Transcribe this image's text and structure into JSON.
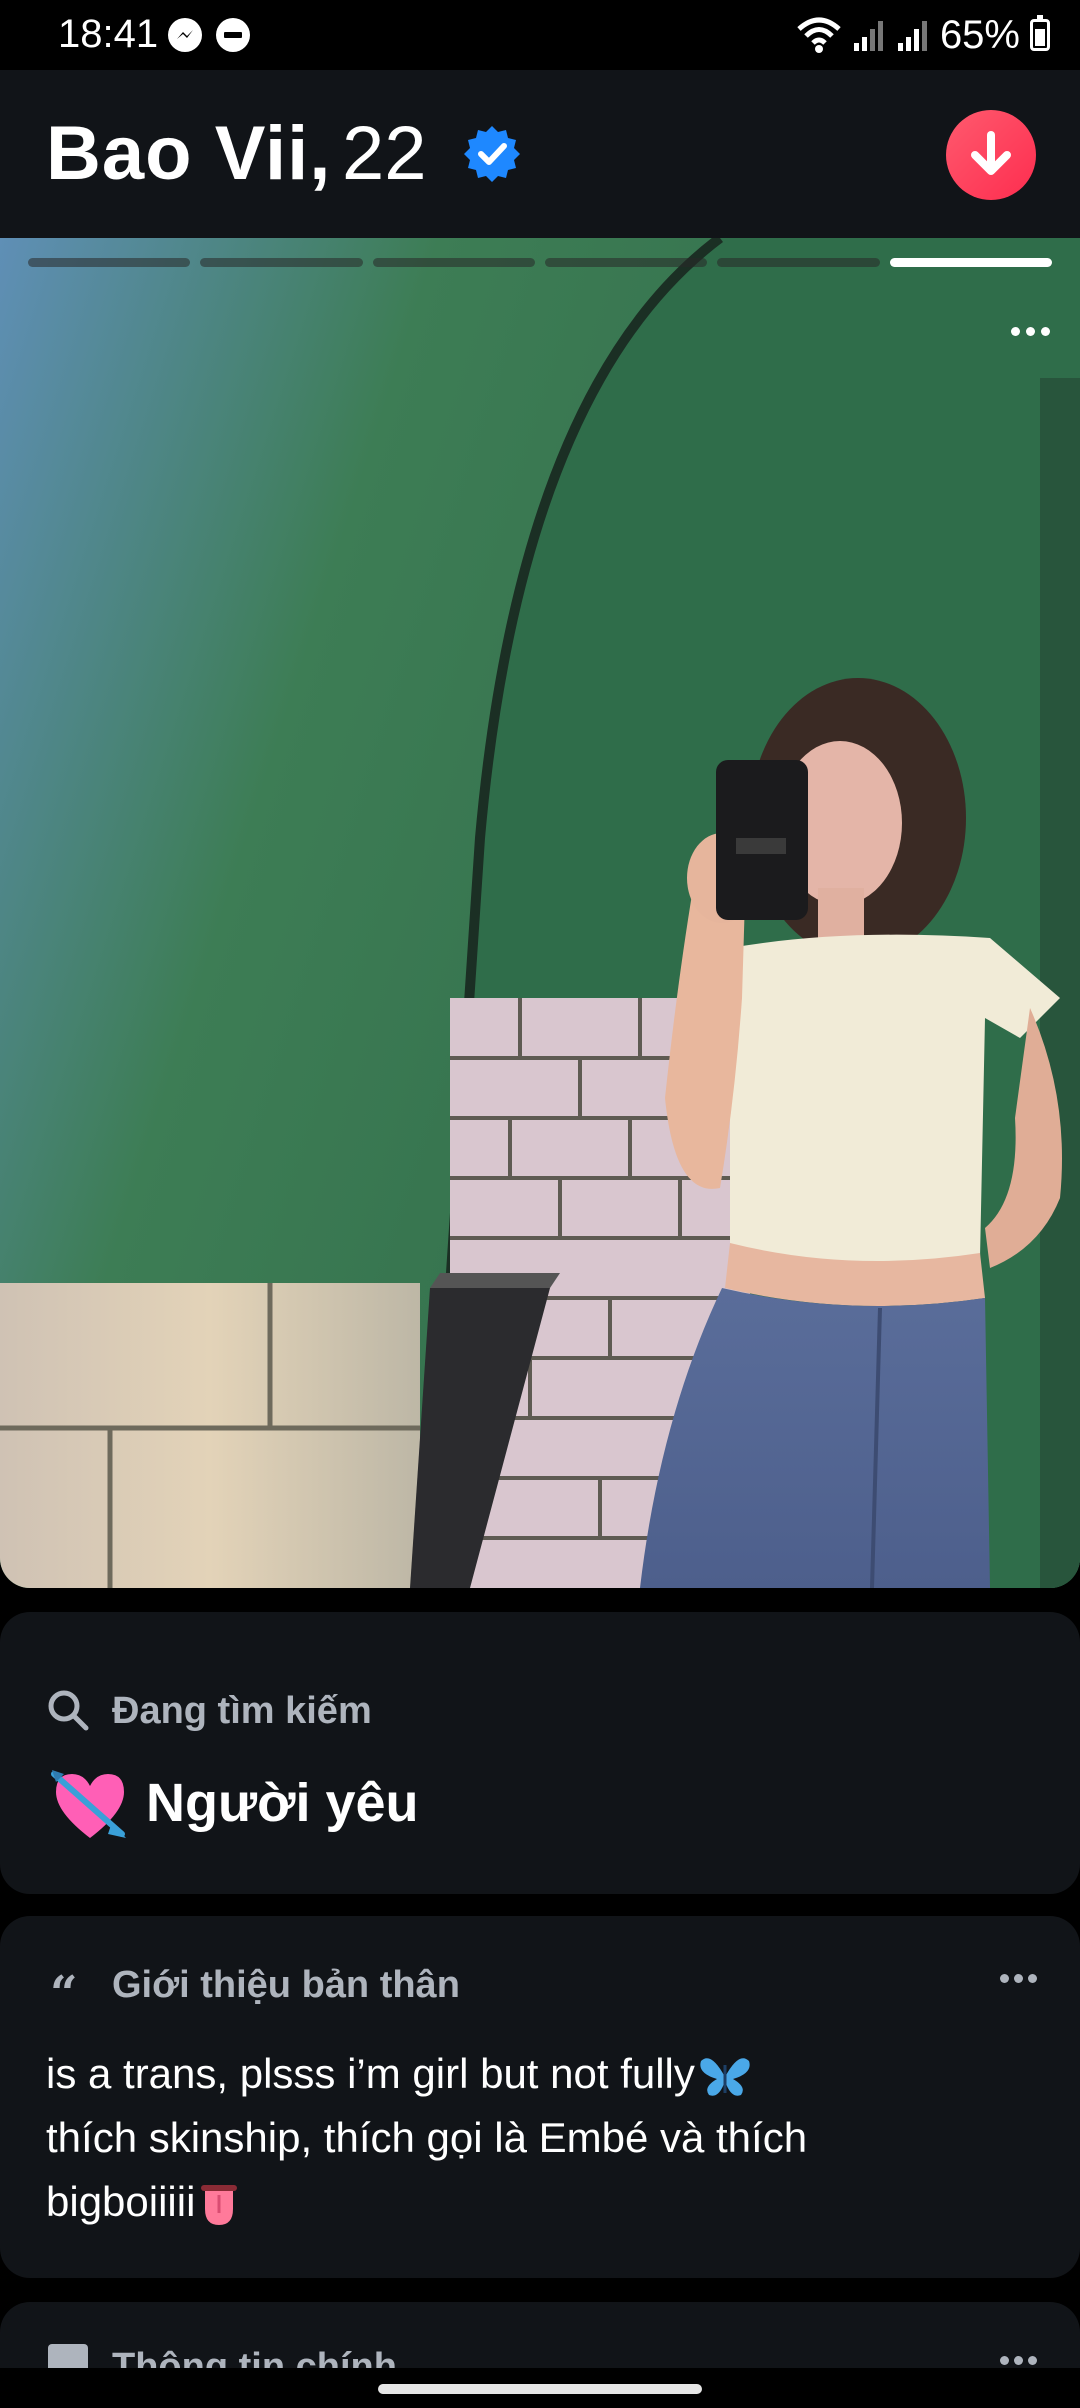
{
  "status_bar": {
    "time": "18:41",
    "battery": "65%",
    "battery_level": 0.65,
    "icons": [
      "messenger-icon",
      "dnd-icon",
      "wifi-icon",
      "signal-icon",
      "signal-icon",
      "battery-icon"
    ]
  },
  "profile": {
    "name": "Bao Vii,",
    "age": "22",
    "verified": true
  },
  "photo": {
    "count": 6,
    "current_index": 6
  },
  "looking_for": {
    "label": "Đang tìm kiếm",
    "value": "Người yêu",
    "icon": "heart-with-arrow-icon"
  },
  "about": {
    "label": "Giới thiệu bản thân",
    "lines": [
      "is a trans, plsss i’m girl but not fully",
      "thích skinship, thích gọi là Embé và thích",
      "bigboiiiii"
    ],
    "emojis": [
      "butterfly-icon",
      "tongue-icon"
    ]
  },
  "basic_info": {
    "label": "Thông tin chính"
  },
  "colors": {
    "background": "#000000",
    "card": "#111418",
    "accent": "#fd2d4f",
    "verified": "#1e88ff",
    "muted": "#aeb4bd"
  }
}
